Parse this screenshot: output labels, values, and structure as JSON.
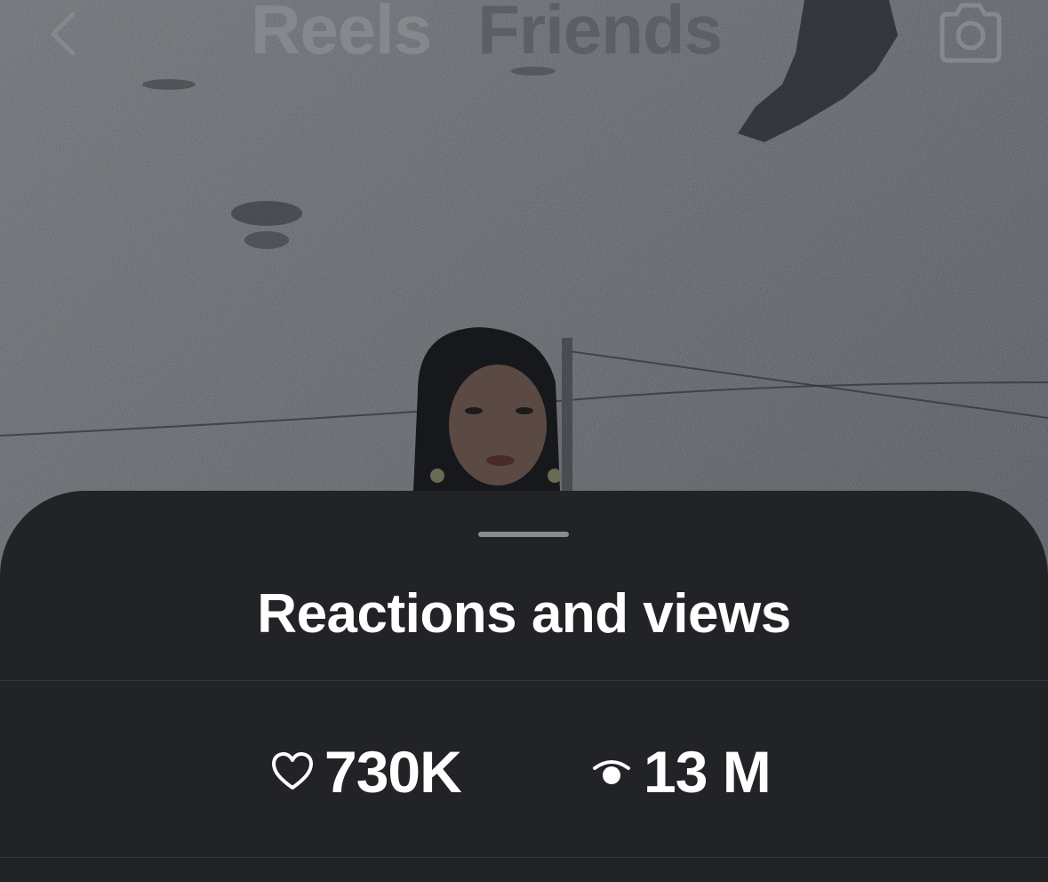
{
  "nav": {
    "tabs": [
      {
        "label": "Reels",
        "active": true
      },
      {
        "label": "Friends",
        "active": false
      }
    ],
    "back_icon": "chevron-left-icon",
    "camera_icon": "camera-icon"
  },
  "sheet": {
    "title": "Reactions and views",
    "stats": {
      "likes": {
        "icon": "heart-icon",
        "value": "730K"
      },
      "views": {
        "icon": "eye-icon",
        "value": "13 M"
      }
    }
  },
  "colors": {
    "sheet_background": "#222327",
    "text_primary": "#ffffff",
    "tab_active": "#86888d",
    "tab_inactive": "#5d5f64"
  }
}
